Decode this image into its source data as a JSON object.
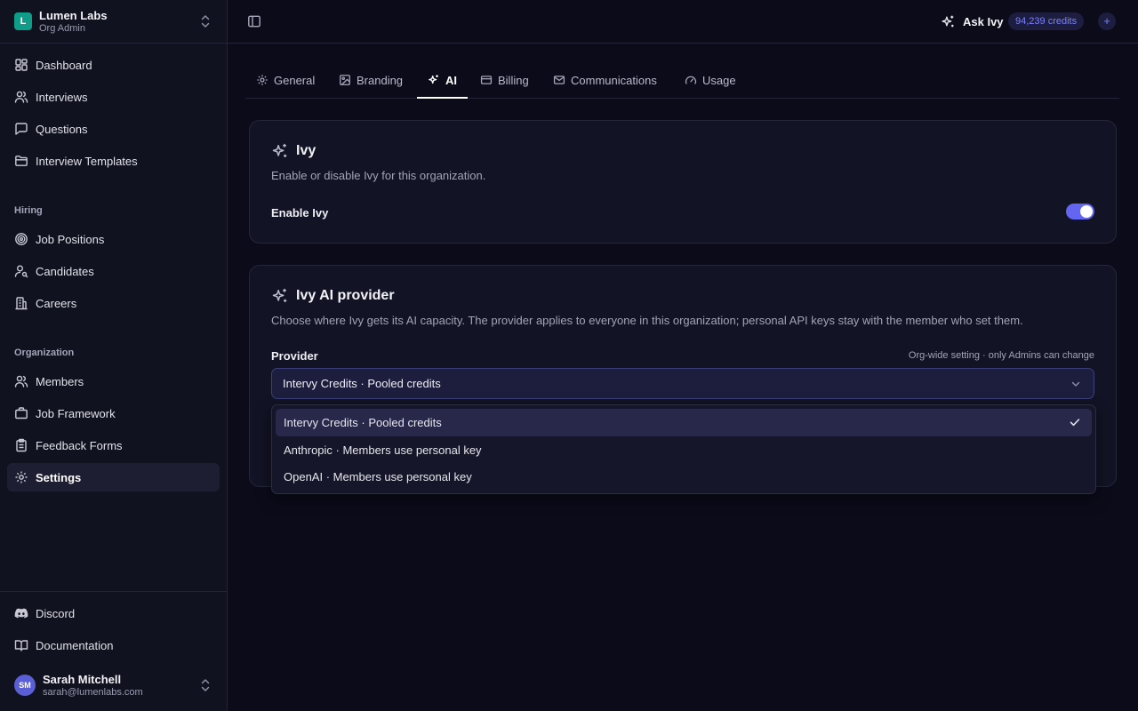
{
  "org": {
    "initial": "L",
    "name": "Lumen Labs",
    "role": "Org Admin",
    "switch_icon": "chevrons-up-down-icon"
  },
  "nav": {
    "main": [
      {
        "label": "Dashboard",
        "icon": "dashboard-icon"
      },
      {
        "label": "Interviews",
        "icon": "users-icon"
      },
      {
        "label": "Questions",
        "icon": "message-square-icon"
      },
      {
        "label": "Interview Templates",
        "icon": "folder-icon"
      }
    ],
    "hiring_label": "Hiring",
    "hiring": [
      {
        "label": "Job Positions",
        "icon": "target-icon"
      },
      {
        "label": "Candidates",
        "icon": "user-search-icon"
      },
      {
        "label": "Careers",
        "icon": "building-icon"
      }
    ],
    "organization_label": "Organization",
    "organization": [
      {
        "label": "Members",
        "icon": "users-icon"
      },
      {
        "label": "Job Framework",
        "icon": "briefcase-icon"
      },
      {
        "label": "Feedback Forms",
        "icon": "clipboard-icon"
      },
      {
        "label": "Settings",
        "icon": "gear-icon",
        "active": true
      }
    ],
    "footer": [
      {
        "label": "Discord",
        "icon": "discord-icon"
      },
      {
        "label": "Documentation",
        "icon": "book-icon"
      }
    ]
  },
  "user": {
    "initials": "SM",
    "name": "Sarah Mitchell",
    "email": "sarah@lumenlabs.com"
  },
  "topbar": {
    "ask_label": "Ask Ivy",
    "credits": "94,239 credits",
    "add_label": "+"
  },
  "tabs": [
    {
      "label": "General",
      "icon": "gear-icon"
    },
    {
      "label": "Branding",
      "icon": "image-icon"
    },
    {
      "label": "AI",
      "icon": "sparkles-icon",
      "active": true
    },
    {
      "label": "Billing",
      "icon": "credit-card-icon"
    },
    {
      "label": "Communications",
      "icon": "mail-icon"
    },
    {
      "label": "Usage",
      "icon": "gauge-icon"
    }
  ],
  "ivy_card": {
    "title": "Ivy",
    "description": "Enable or disable Ivy for this organization.",
    "enable_label": "Enable Ivy",
    "enabled": true
  },
  "provider_card": {
    "title": "Ivy AI provider",
    "description": "Choose where Ivy gets its AI capacity. The provider applies to everyone in this organization; personal API keys stay with the member who set them.",
    "provider_label": "Provider",
    "provider_hint": "Org-wide setting · only Admins can change",
    "selected": "Intervy Credits · Pooled credits",
    "options": [
      {
        "label": "Intervy Credits · Pooled credits",
        "selected": true
      },
      {
        "label": "Anthropic · Members use personal key"
      },
      {
        "label": "OpenAI · Members use personal key"
      }
    ]
  },
  "colors": {
    "accent": "#6366f1",
    "badge_text": "#7b80ff",
    "org_logo": "#0f9d8a",
    "background": "#0b0b1a",
    "sidebar": "#11121f"
  }
}
